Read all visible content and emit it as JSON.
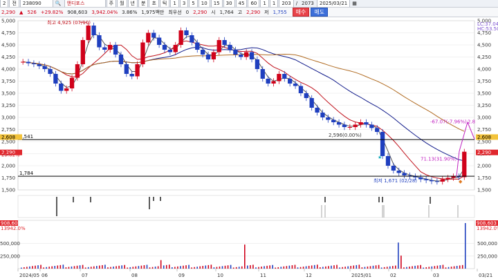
{
  "toolbar1": {
    "num_field": "2",
    "mode": "전",
    "code": "238090",
    "name": "앤디포스",
    "periods": [
      "주",
      "월",
      "년",
      "분",
      "초",
      "틱",
      "1",
      "3",
      "5",
      "10",
      "15",
      "30",
      "45",
      "60",
      "1",
      "1"
    ],
    "range": "203",
    "range_total": "2073",
    "date": "2025/03/21"
  },
  "toolbar2": {
    "price": "2,290",
    "change": "526",
    "change_pct": "+29.82%",
    "volume": "908,603",
    "volume2": "3,942.04%",
    "ratio": "3.86%",
    "amount": "1,975백만",
    "best_label": "최우선",
    "zero": "0",
    "ask": "2,290",
    "open_label": "시",
    "open": "1,764",
    "high_label": "고",
    "high": "2,290",
    "low_label": "저",
    "low": "1,755",
    "buy_label": "매수",
    "sell_label": "매도"
  },
  "colors": {
    "up": "#d0021b",
    "down": "#1f3fbf",
    "ma5": "#555555",
    "ma20": "#c0101a",
    "ma60": "#101a8a",
    "ma120": "#b06a20"
  },
  "chart_data": {
    "type": "candlestick",
    "y_ticks": [
      "5,000",
      "4,750",
      "4,500",
      "4,250",
      "4,000",
      "3,750",
      "3,500",
      "3,250",
      "3,000",
      "2,750",
      "2,500",
      "2,250",
      "2,000",
      "1,750",
      "1,500"
    ],
    "ylim": [
      1500,
      5000
    ],
    "x_labels": [
      "2024/05",
      "06",
      "07",
      "08",
      "09",
      "10",
      "11",
      "12",
      "2025/01",
      "02",
      "03",
      "03/21"
    ],
    "levels": [
      {
        "label": "2,541",
        "value": 2541
      },
      {
        "label": "1,784",
        "value": 1784
      }
    ],
    "right_tags": {
      "current": "2,290",
      "current_pct": "29.82%",
      "prev": "2,608",
      "lc": "LC:37.04",
      "hc": "HC:53.50"
    },
    "annotations": {
      "high": "최고 4,925 (07/10)",
      "low": "최저 1,671 (02/28)",
      "mid": "2,596(0.00%)",
      "rise": "71.13(31.90%)",
      "fall": "-67.07(-7.96%)",
      "end": "2.8"
    },
    "close_values": [
      4150,
      4120,
      4100,
      4060,
      4000,
      3900,
      3700,
      3550,
      3600,
      3820,
      4100,
      4600,
      4900,
      4700,
      4450,
      4400,
      4500,
      4300,
      4100,
      3900,
      3850,
      4100,
      4550,
      4750,
      4650,
      4500,
      4400,
      4350,
      4500,
      4800,
      4700,
      4550,
      4400,
      4300,
      4200,
      4350,
      4600,
      4500,
      4400,
      4300,
      4250,
      4350,
      4200,
      4000,
      3800,
      3700,
      3750,
      3900,
      3800,
      3700,
      3650,
      3500,
      3400,
      3200,
      3100,
      3000,
      2950,
      2900,
      2850,
      2800,
      2800,
      2850,
      2900,
      2850,
      2780,
      2700,
      2200,
      2000,
      1900,
      1850,
      1800,
      1780,
      1760,
      1720,
      1700,
      1680,
      1671,
      1720,
      1750,
      1780,
      1764,
      2290
    ],
    "volume_ticks": [
      "500,000",
      "250,000"
    ],
    "volume_tags": {
      "volume": "908,603",
      "volume_pct": "13942.0%"
    }
  }
}
